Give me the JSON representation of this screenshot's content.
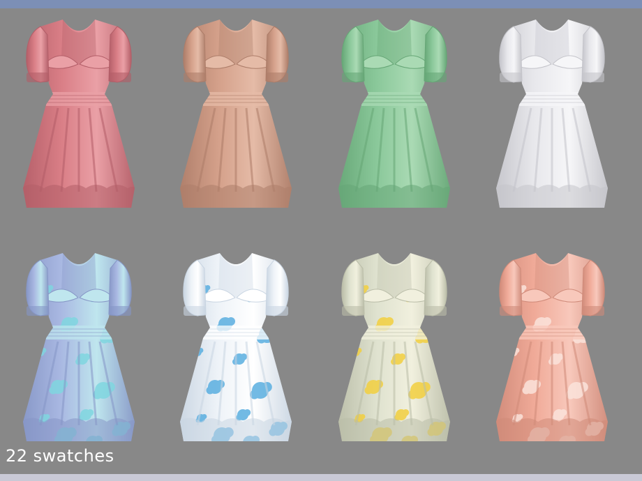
{
  "caption": "22 swatches",
  "colors": {
    "background": "#888888",
    "top_bar": "#7c8fb6",
    "bottom_bar": "#c9c9d6"
  },
  "dresses": [
    {
      "name": "solid-pink",
      "base": "#d97e86",
      "shade": "#b35e68",
      "light": "#eaa0a6",
      "pattern": "none"
    },
    {
      "name": "solid-tan",
      "base": "#d4a08a",
      "shade": "#ad7d69",
      "light": "#e5bba7",
      "pattern": "none"
    },
    {
      "name": "solid-green",
      "base": "#8ac89a",
      "shade": "#66a676",
      "light": "#aadab4",
      "pattern": "none"
    },
    {
      "name": "solid-white",
      "base": "#e8e8ec",
      "shade": "#c4c4ca",
      "light": "#f6f6f8",
      "pattern": "none"
    },
    {
      "name": "floral-lilac",
      "base": "#a9b8e2",
      "shade": "#8696c6",
      "light": "#bfe6ee",
      "pattern": "#7fd6e0"
    },
    {
      "name": "floral-white-blue",
      "base": "#eef3f8",
      "shade": "#c9d5e2",
      "light": "#ffffff",
      "pattern": "#5aaee0"
    },
    {
      "name": "floral-yellow",
      "base": "#dfe2cf",
      "shade": "#babda8",
      "light": "#f1f0de",
      "pattern": "#f2cf3f"
    },
    {
      "name": "floral-peach",
      "base": "#f0aa98",
      "shade": "#cf8a79",
      "light": "#f8c8bb",
      "pattern": "#fbe3db"
    }
  ]
}
